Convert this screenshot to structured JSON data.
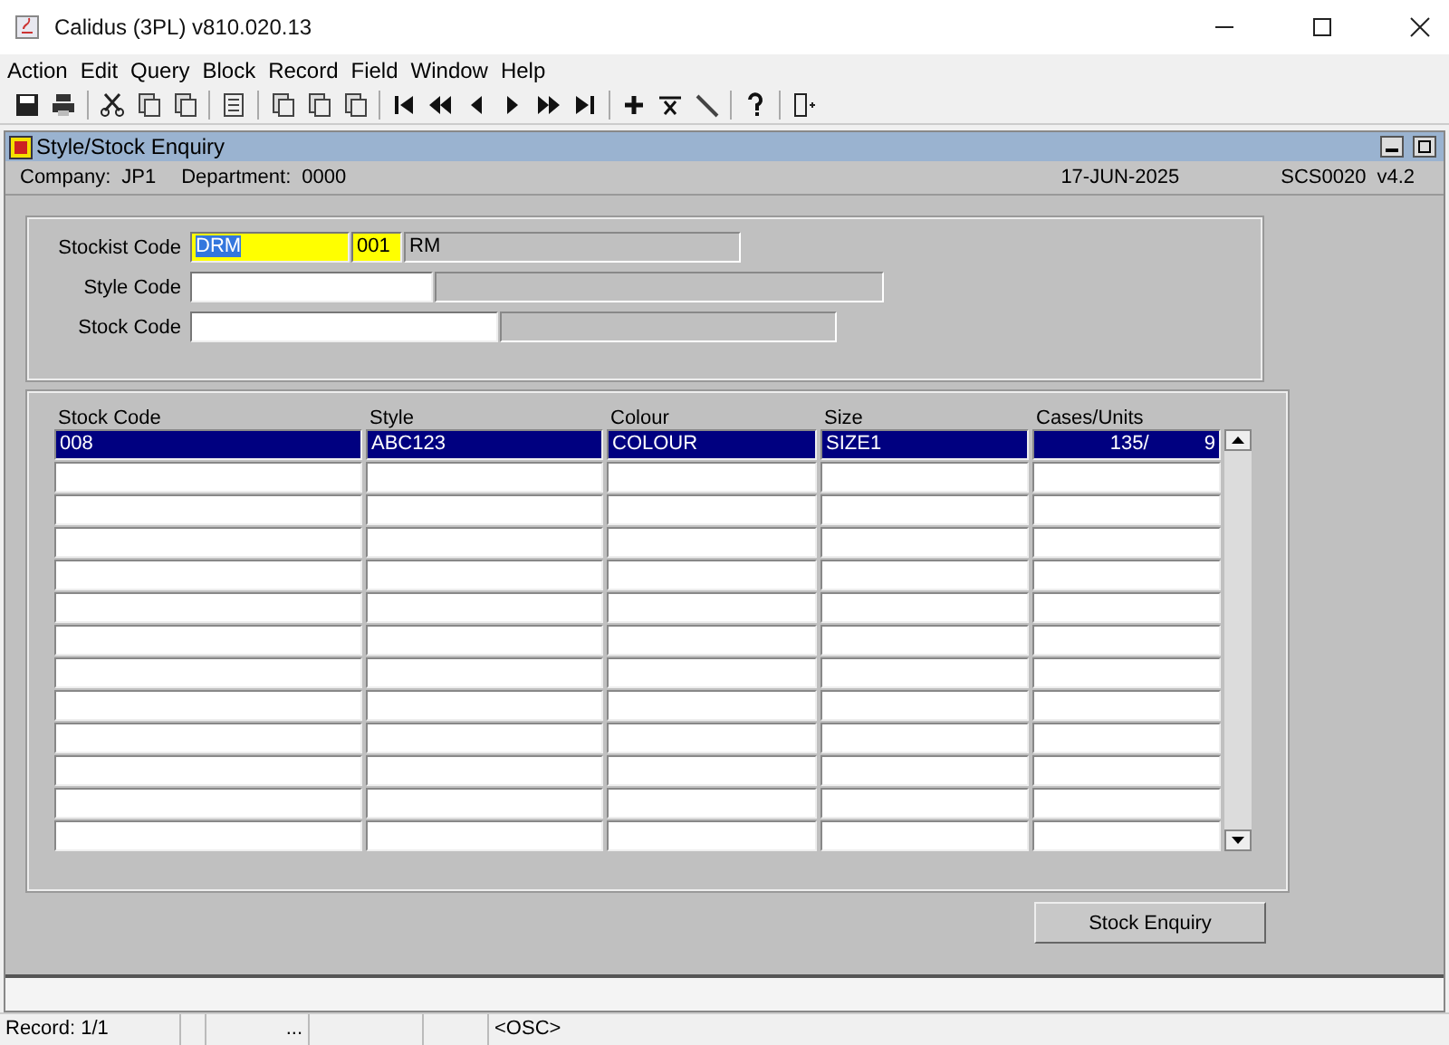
{
  "window": {
    "title": "Calidus (3PL) v810.020.13"
  },
  "menu": [
    "Action",
    "Edit",
    "Query",
    "Block",
    "Record",
    "Field",
    "Window",
    "Help"
  ],
  "form": {
    "title": "Style/Stock Enquiry",
    "company_label": "Company:",
    "company": "JP1",
    "department_label": "Department:",
    "department": "0000",
    "date": "17-JUN-2025",
    "screen": "SCS0020",
    "version": "v4.2"
  },
  "fields": [
    {
      "label": "Stockist Code",
      "value": "DRM",
      "value2": "001",
      "description": "RM",
      "focused": true
    },
    {
      "label": "Style Code",
      "focused": false
    },
    {
      "label": "Stock Code",
      "focused": false
    }
  ],
  "table": {
    "columns": [
      "Stock Code",
      "Style",
      "Colour",
      "Size",
      "Cases/Units"
    ],
    "rows": [
      {
        "selected": true,
        "cells": [
          "008",
          "ABC123",
          "COLOUR",
          "SIZE1",
          "135/          9"
        ]
      },
      {
        "selected": false
      },
      {
        "selected": false
      },
      {
        "selected": false
      },
      {
        "selected": false
      },
      {
        "selected": false
      },
      {
        "selected": false
      },
      {
        "selected": false
      },
      {
        "selected": false
      },
      {
        "selected": false
      },
      {
        "selected": false
      },
      {
        "selected": false
      },
      {
        "selected": false
      }
    ]
  },
  "button": "Stock Enquiry",
  "status_bar": {
    "record": "Record: 1/1",
    "indicator": "...",
    "mode": "<OSC>"
  }
}
